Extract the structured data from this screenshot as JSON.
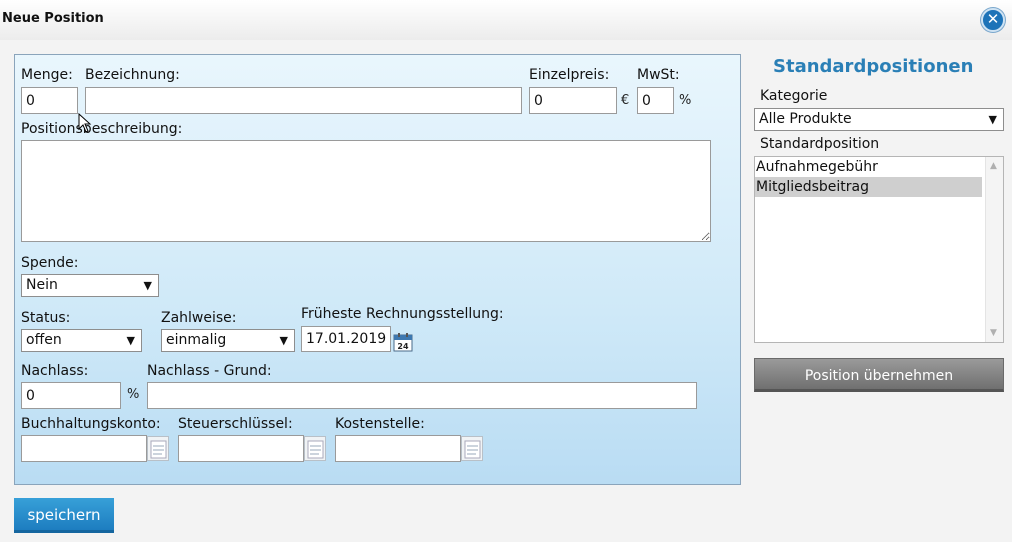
{
  "dialog": {
    "title": "Neue Position",
    "close_icon": "close-icon"
  },
  "form": {
    "menge": {
      "label": "Menge:",
      "value": "0"
    },
    "bezeichnung": {
      "label": "Bezeichnung:",
      "value": ""
    },
    "einzelpreis": {
      "label": "Einzelpreis:",
      "value": "0",
      "unit": "€"
    },
    "mwst": {
      "label": "MwSt:",
      "value": "0",
      "unit": "%"
    },
    "positionsbeschreibung": {
      "label": "Positionsbeschreibung:",
      "value": ""
    },
    "spende": {
      "label": "Spende:",
      "selected": "Nein"
    },
    "status": {
      "label": "Status:",
      "selected": "offen"
    },
    "zahlweise": {
      "label": "Zahlweise:",
      "selected": "einmalig"
    },
    "rechnungsstellung": {
      "label": "Früheste Rechnungsstellung:",
      "value": "17.01.2019",
      "calendar_icon": "calendar-icon"
    },
    "nachlass": {
      "label": "Nachlass:",
      "value": "0",
      "unit": "%"
    },
    "nachlass_grund": {
      "label": "Nachlass - Grund:",
      "value": ""
    },
    "buchhaltungskonto": {
      "label": "Buchhaltungskonto:",
      "value": ""
    },
    "steuerschluessel": {
      "label": "Steuerschlüssel:",
      "value": ""
    },
    "kostenstelle": {
      "label": "Kostenstelle:",
      "value": ""
    },
    "save_label": "speichern"
  },
  "standard": {
    "title": "Standardpositionen",
    "kategorie_label": "Kategorie",
    "kategorie_selected": "Alle Produkte",
    "position_label": "Standardposition",
    "items": [
      "Aufnahmegebühr",
      "Mitgliedsbeitrag"
    ],
    "selected_item": "Mitgliedsbeitrag",
    "apply_label": "Position übernehmen"
  },
  "colors": {
    "accent": "#2a7fb6",
    "save_button": "#1d7dc0",
    "panel": "#cfe9f8"
  }
}
